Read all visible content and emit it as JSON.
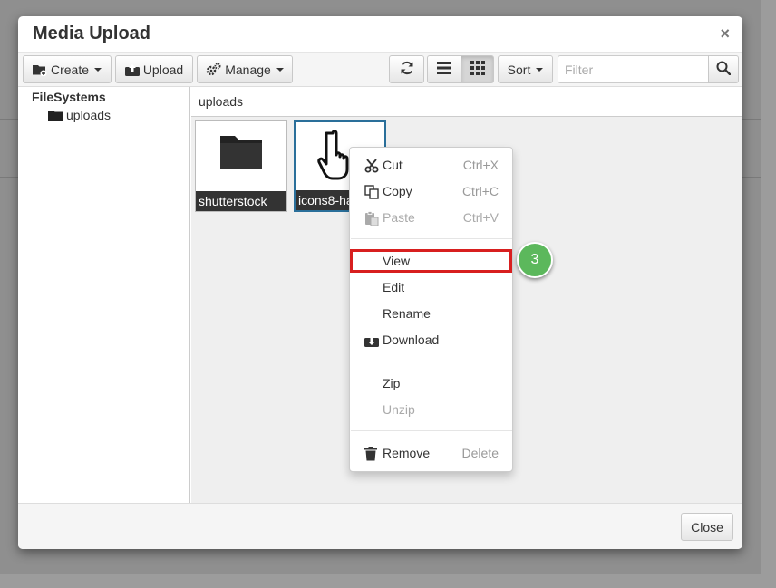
{
  "dialog": {
    "title": "Media Upload",
    "close_symbol": "×"
  },
  "toolbar": {
    "create_label": "Create",
    "upload_label": "Upload",
    "manage_label": "Manage",
    "refresh_icon": "refresh-icon",
    "list_view_icon": "list-icon",
    "grid_view_icon": "grid-icon",
    "sort_label": "Sort",
    "filter_placeholder": "Filter",
    "search_icon": "search-icon"
  },
  "sidebar": {
    "root_label": "FileSystems",
    "child_label": "uploads"
  },
  "main": {
    "path": "uploads",
    "tiles": [
      {
        "label": "shutterstock",
        "icon": "folder-icon"
      },
      {
        "label": "icons8-ha",
        "icon": "hand-pointer-icon"
      }
    ]
  },
  "context_menu": {
    "items": [
      {
        "label": "Cut",
        "shortcut": "Ctrl+X",
        "icon": "scissors-icon"
      },
      {
        "label": "Copy",
        "shortcut": "Ctrl+C",
        "icon": "copy-icon"
      },
      {
        "label": "Paste",
        "shortcut": "Ctrl+V",
        "icon": "paste-icon"
      },
      {
        "label": "View",
        "shortcut": ""
      },
      {
        "label": "Edit",
        "shortcut": ""
      },
      {
        "label": "Rename",
        "shortcut": ""
      },
      {
        "label": "Download",
        "shortcut": "",
        "icon": "download-icon"
      },
      {
        "label": "Zip",
        "shortcut": ""
      },
      {
        "label": "Unzip",
        "shortcut": ""
      },
      {
        "label": "Remove",
        "shortcut": "Delete",
        "icon": "trash-icon"
      }
    ]
  },
  "footer": {
    "close_label": "Close"
  },
  "annotation": {
    "step_number": "3",
    "highlight_color": "#d81f1f",
    "badge_color": "#5cb85c"
  }
}
